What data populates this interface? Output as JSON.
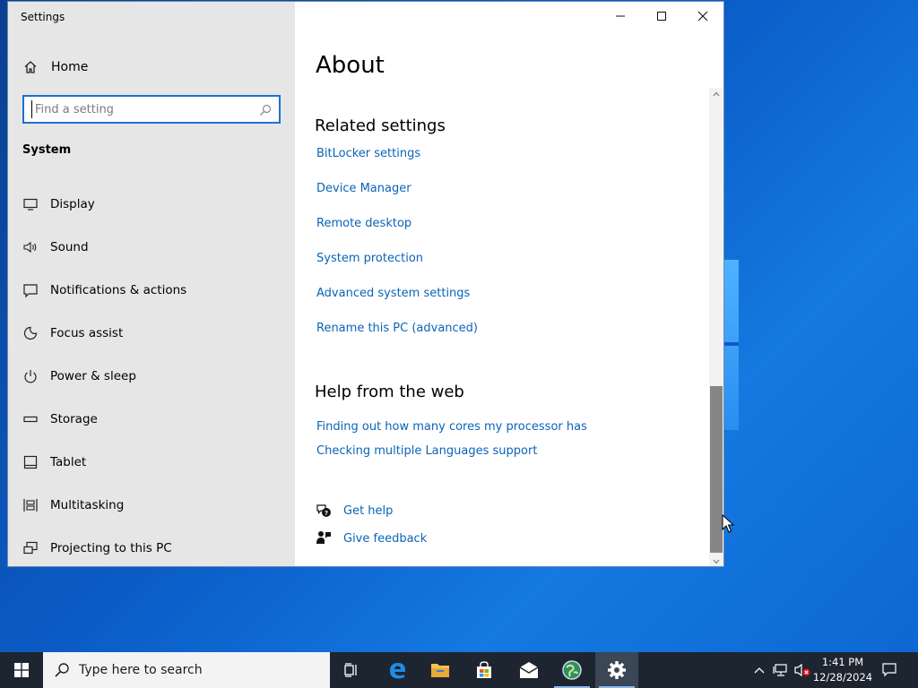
{
  "window": {
    "title": "Settings"
  },
  "sidebar": {
    "home_label": "Home",
    "search_placeholder": "Find a setting",
    "section_label": "System",
    "items": [
      {
        "label": "Display",
        "icon": "display-icon"
      },
      {
        "label": "Sound",
        "icon": "sound-icon"
      },
      {
        "label": "Notifications & actions",
        "icon": "notifications-icon"
      },
      {
        "label": "Focus assist",
        "icon": "focus-assist-icon"
      },
      {
        "label": "Power & sleep",
        "icon": "power-icon"
      },
      {
        "label": "Storage",
        "icon": "storage-icon"
      },
      {
        "label": "Tablet",
        "icon": "tablet-icon"
      },
      {
        "label": "Multitasking",
        "icon": "multitasking-icon"
      },
      {
        "label": "Projecting to this PC",
        "icon": "projecting-icon"
      }
    ]
  },
  "main": {
    "title": "About",
    "related_heading": "Related settings",
    "related_links": [
      "BitLocker settings",
      "Device Manager",
      "Remote desktop",
      "System protection",
      "Advanced system settings",
      "Rename this PC (advanced)"
    ],
    "web_heading": "Help from the web",
    "web_links": [
      "Finding out how many cores my processor has",
      "Checking multiple Languages support"
    ],
    "get_help": "Get help",
    "give_feedback": "Give feedback"
  },
  "taskbar": {
    "search_placeholder": "Type here to search",
    "time": "1:41 PM",
    "date": "12/28/2024"
  },
  "colors": {
    "link": "#0a64b8",
    "sidebar_bg": "#e6e6e6",
    "accent": "#1f6fd4",
    "taskbar_bg": "#1d2530"
  }
}
